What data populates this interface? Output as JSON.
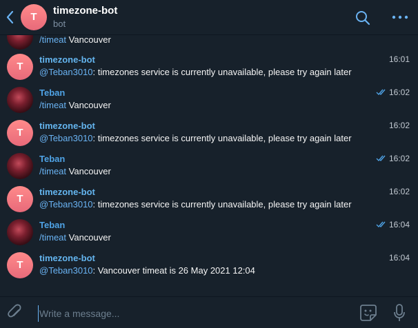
{
  "header": {
    "title": "timezone-bot",
    "subtitle": "bot",
    "avatar_letter": "T"
  },
  "messages": [
    {
      "sender": "",
      "prefix": "/timeat",
      "body": " Vancouver",
      "time": ""
    },
    {
      "sender": "timezone-bot",
      "prefix": "@Teban3010",
      "body": ": timezones service is currently unavailable, please try again later",
      "time": "16:01"
    },
    {
      "sender": "Teban",
      "prefix": "/timeat",
      "body": " Vancouver",
      "time": "16:02"
    },
    {
      "sender": "timezone-bot",
      "prefix": "@Teban3010",
      "body": ": timezones service is currently unavailable, please try again later",
      "time": "16:02"
    },
    {
      "sender": "Teban",
      "prefix": "/timeat",
      "body": " Vancouver",
      "time": "16:02"
    },
    {
      "sender": "timezone-bot",
      "prefix": "@Teban3010",
      "body": ": timezones service is currently unavailable, please try again later",
      "time": "16:02"
    },
    {
      "sender": "Teban",
      "prefix": "/timeat",
      "body": " Vancouver",
      "time": "16:04"
    },
    {
      "sender": "timezone-bot",
      "prefix": "@Teban3010",
      "body": ": Vancouver timeat is 26 May 2021 12:04",
      "time": "16:04"
    }
  ],
  "bot_avatar_letter": "T",
  "composer": {
    "placeholder": "Write a message..."
  },
  "icons": {
    "back": "back-chevron-icon",
    "search": "search-icon",
    "more": "more-dots-icon",
    "attach": "paperclip-icon",
    "emoji": "sticker-emoji-icon",
    "mic": "microphone-icon",
    "read": "double-check-icon"
  },
  "colors": {
    "background": "#17212b",
    "accent": "#6ab3f3",
    "bot_avatar": "#ff8a8a"
  }
}
